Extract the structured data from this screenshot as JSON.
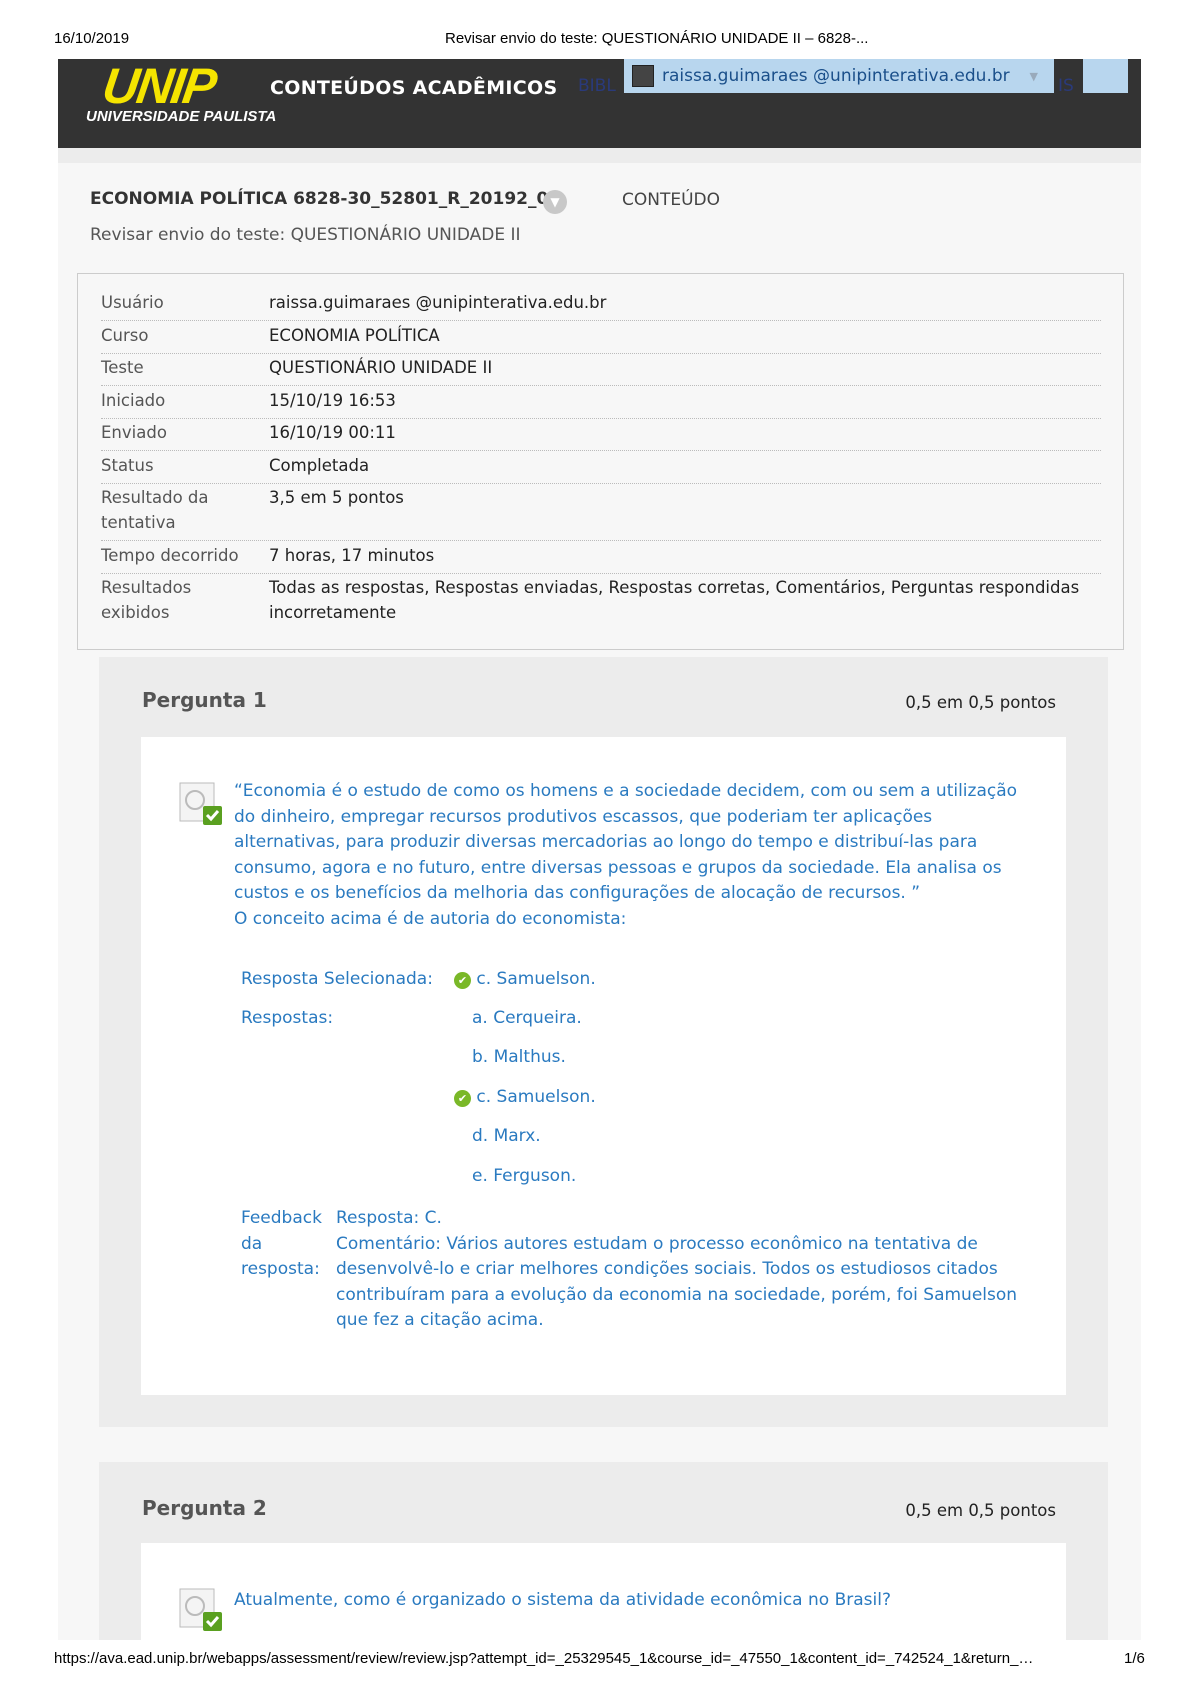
{
  "print_header": {
    "date": "16/10/2019",
    "title": "Revisar envio do teste: QUESTIONÁRIO UNIDADE II – 6828-..."
  },
  "print_footer": {
    "url": "https://ava.ead.unip.br/webapps/assessment/review/review.jsp?attempt_id=_25329545_1&course_id=_47550_1&content_id=_742524_1&return_…",
    "page": "1/6"
  },
  "topbar": {
    "logo": "UNIP",
    "logo_sub": "UNIVERSIDADE PAULISTA",
    "brand": "CONTEÚDOS ACADÊMICOS",
    "nav_partial": "BIBL",
    "nav_partial2": "IS",
    "user": "raissa.guimaraes @unipinterativa.edu.br",
    "brand_color": "#f5e400"
  },
  "breadcrumb": {
    "course": "ECONOMIA POLÍTICA 6828-30_52801_R_20192_01",
    "section": "CONTEÚDO",
    "page": "Revisar envio do teste: QUESTIONÁRIO UNIDADE II"
  },
  "info": [
    {
      "label": "Usuário",
      "value": "raissa.guimaraes @unipinterativa.edu.br"
    },
    {
      "label": "Curso",
      "value": "ECONOMIA POLÍTICA"
    },
    {
      "label": "Teste",
      "value": "QUESTIONÁRIO UNIDADE II"
    },
    {
      "label": "Iniciado",
      "value": "15/10/19 16:53"
    },
    {
      "label": "Enviado",
      "value": "16/10/19 00:11"
    },
    {
      "label": "Status",
      "value": "Completada"
    },
    {
      "label": "Resultado da tentativa",
      "value": "3,5 em 5 pontos"
    },
    {
      "label": "Tempo decorrido",
      "value": "7 horas, 17 minutos"
    },
    {
      "label": "Resultados exibidos",
      "value": "Todas as respostas, Respostas enviadas, Respostas corretas, Comentários, Perguntas respondidas incorretamente"
    }
  ],
  "questions": [
    {
      "title": "Pergunta 1",
      "points": "0,5 em 0,5 pontos",
      "text": "“Economia é o estudo de como os homens e a sociedade decidem, com ou sem a utilização do dinheiro, empregar recursos produtivos escassos, que poderiam ter aplicações alternativas, para produzir diversas mercadorias ao longo do tempo e distribuí-las para consumo, agora e no futuro, entre diversas pessoas e grupos da sociedade. Ela analisa os custos e os benefícios da melhoria das configurações de alocação de recursos. ”",
      "text2": "O conceito acima é de autoria do economista:",
      "selected_label": "Resposta Selecionada:",
      "selected": "c. Samuelson.",
      "answers_label": "Respostas:",
      "answers": [
        "a. Cerqueira.",
        "b. Malthus.",
        "c. Samuelson.",
        "d. Marx.",
        "e. Ferguson."
      ],
      "correct_index": 2,
      "feedback_label": "Feedback da resposta:",
      "feedback_answer": "Resposta: C.",
      "feedback_comment": "Comentário: Vários autores estudam o processo econômico na tentativa de desenvolvê-lo e criar melhores condições sociais. Todos os estudiosos citados contribuíram para a evolução da economia na sociedade, porém, foi Samuelson que fez a citação acima."
    },
    {
      "title": "Pergunta 2",
      "points": "0,5 em 0,5 pontos",
      "text": "Atualmente, como é organizado o sistema da atividade econômica no Brasil?"
    }
  ]
}
